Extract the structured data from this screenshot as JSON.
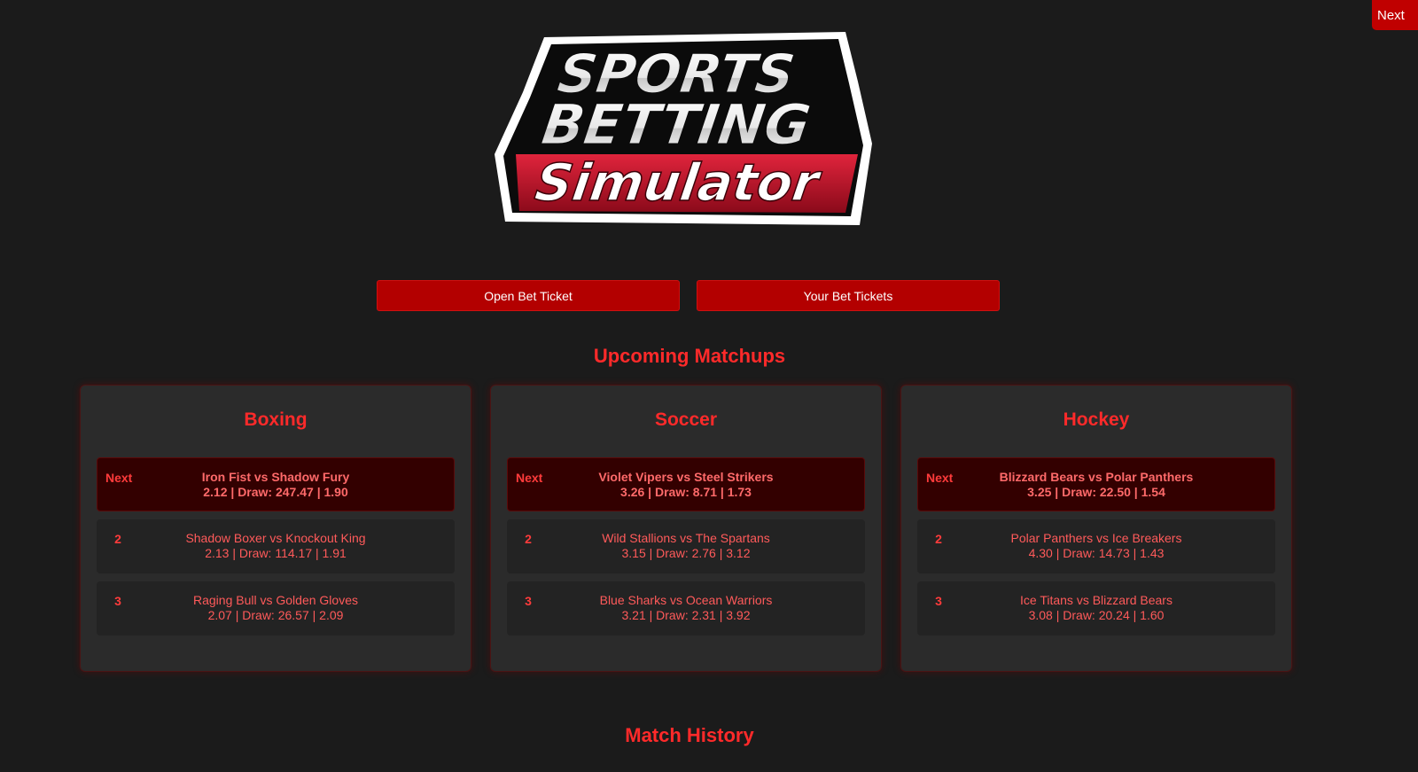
{
  "header": {
    "next_label": "Next",
    "logo": {
      "line1": "SPORTS",
      "line2": "BETTING",
      "line3": "Simulator"
    }
  },
  "actions": {
    "open_ticket": "Open Bet Ticket",
    "your_tickets": "Your Bet Tickets"
  },
  "upcoming": {
    "title": "Upcoming Matchups",
    "sports": [
      {
        "name": "Boxing",
        "matches": [
          {
            "rank": "Next",
            "teams": "Iron Fist vs Shadow Fury",
            "odds": "2.12 | Draw: 247.47 | 1.90"
          },
          {
            "rank": "2",
            "teams": "Shadow Boxer vs Knockout King",
            "odds": "2.13 | Draw: 114.17 | 1.91"
          },
          {
            "rank": "3",
            "teams": "Raging Bull vs Golden Gloves",
            "odds": "2.07 | Draw: 26.57 | 2.09"
          }
        ]
      },
      {
        "name": "Soccer",
        "matches": [
          {
            "rank": "Next",
            "teams": "Violet Vipers vs Steel Strikers",
            "odds": "3.26 | Draw: 8.71 | 1.73"
          },
          {
            "rank": "2",
            "teams": "Wild Stallions vs The Spartans",
            "odds": "3.15 | Draw: 2.76 | 3.12"
          },
          {
            "rank": "3",
            "teams": "Blue Sharks vs Ocean Warriors",
            "odds": "3.21 | Draw: 2.31 | 3.92"
          }
        ]
      },
      {
        "name": "Hockey",
        "matches": [
          {
            "rank": "Next",
            "teams": "Blizzard Bears vs Polar Panthers",
            "odds": "3.25 | Draw: 22.50 | 1.54"
          },
          {
            "rank": "2",
            "teams": "Polar Panthers vs Ice Breakers",
            "odds": "4.30 | Draw: 14.73 | 1.43"
          },
          {
            "rank": "3",
            "teams": "Ice Titans vs Blizzard Bears",
            "odds": "3.08 | Draw: 20.24 | 1.60"
          }
        ]
      }
    ]
  },
  "history": {
    "title": "Match History"
  },
  "colors": {
    "background": "#1b1b1b",
    "accent": "#c00000",
    "title_red": "#ff2a2a",
    "card_bg": "#2b2b2b"
  }
}
